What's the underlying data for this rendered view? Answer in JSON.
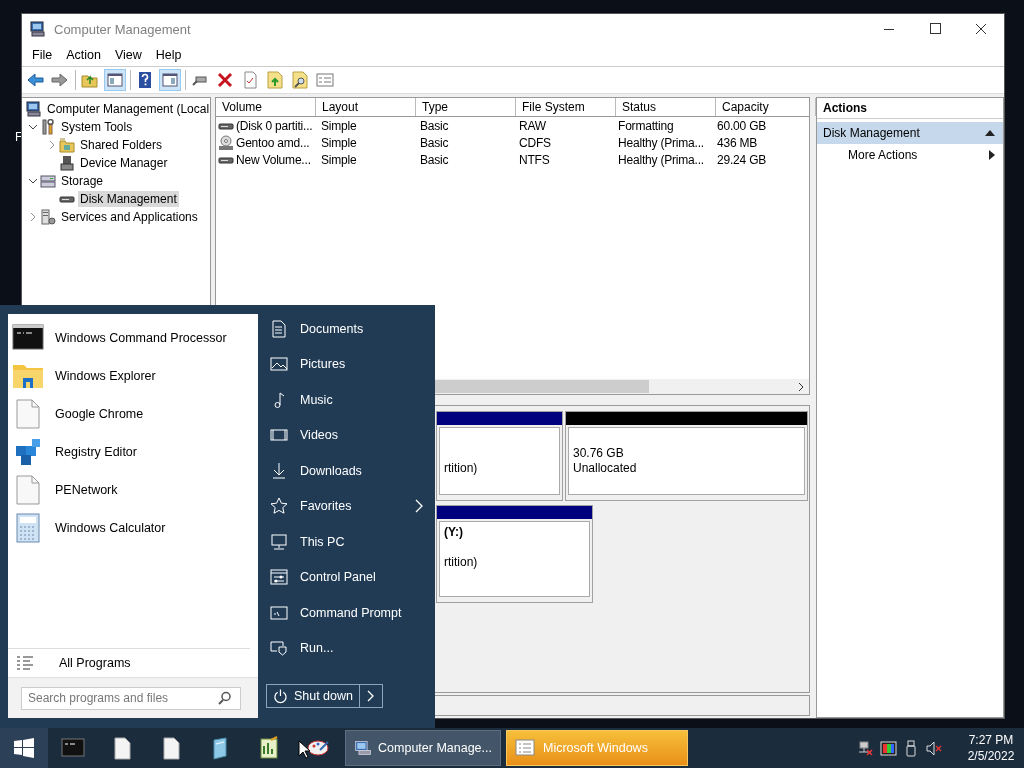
{
  "desktop": {
    "fragment": "F"
  },
  "window": {
    "title": "Computer Management"
  },
  "menu_bar": [
    "File",
    "Action",
    "View",
    "Help"
  ],
  "toolbar": [
    {
      "kind": "back",
      "pressed": false
    },
    {
      "kind": "forward",
      "pressed": false
    },
    {
      "kind": "separator"
    },
    {
      "kind": "up",
      "pressed": false
    },
    {
      "kind": "tree",
      "pressed": true
    },
    {
      "kind": "separator"
    },
    {
      "kind": "help",
      "pressed": false
    },
    {
      "kind": "pane",
      "pressed": true
    },
    {
      "kind": "separator"
    },
    {
      "kind": "connect",
      "pressed": false
    },
    {
      "kind": "delete",
      "pressed": false
    },
    {
      "kind": "properties",
      "pressed": false
    },
    {
      "kind": "export",
      "pressed": false
    },
    {
      "kind": "find",
      "pressed": false
    },
    {
      "kind": "list",
      "pressed": false
    }
  ],
  "tree": [
    {
      "label": "Computer Management (Local",
      "kind": "computer",
      "selected": false,
      "children": [
        {
          "label": "System Tools",
          "kind": "tools",
          "expanded": true,
          "selected": false,
          "children": [
            {
              "label": "Shared Folders",
              "kind": "share",
              "expanded": false,
              "selected": false
            },
            {
              "label": "Device Manager",
              "kind": "device",
              "selected": false
            }
          ]
        },
        {
          "label": "Storage",
          "kind": "storage",
          "expanded": true,
          "selected": false,
          "children": [
            {
              "label": "Disk Management",
              "kind": "disk",
              "selected": true
            }
          ]
        },
        {
          "label": "Services and Applications",
          "kind": "services",
          "expanded": false,
          "selected": false
        }
      ]
    }
  ],
  "table": {
    "columns": [
      "Volume",
      "Layout",
      "Type",
      "File System",
      "Status",
      "Capacity"
    ],
    "rows": [
      {
        "kind": "disk",
        "cells": [
          "(Disk 0 partiti...",
          "Simple",
          "Basic",
          "RAW",
          "Formatting",
          "60.00 GB"
        ]
      },
      {
        "kind": "cd",
        "cells": [
          "Gentoo amd...",
          "Simple",
          "Basic",
          "CDFS",
          "Healthy (Prima...",
          "436 MB"
        ]
      },
      {
        "kind": "disk",
        "cells": [
          "New Volume...",
          "Simple",
          "Basic",
          "NTFS",
          "Healthy (Prima...",
          "29.24 GB"
        ]
      }
    ]
  },
  "disk_map": [
    {
      "partitions": [
        {
          "color": "#00007f",
          "status": "rtition)"
        },
        {
          "color": "#000000",
          "size": "30.76 GB",
          "status": "Unallocated"
        }
      ]
    },
    {
      "partitions": [
        {
          "color": "#00007f",
          "name": "(Y:)",
          "status": "rtition)"
        }
      ]
    }
  ],
  "actions": {
    "title": "Actions",
    "sections": [
      {
        "label": "Disk Management",
        "expanded": true,
        "items": [
          {
            "label": "More Actions",
            "submenu": true
          }
        ]
      }
    ]
  },
  "start_menu": {
    "programs": [
      {
        "label": "Windows Command Processor",
        "kind": "cmd"
      },
      {
        "label": "Windows Explorer",
        "kind": "explorer"
      },
      {
        "label": "Google Chrome",
        "kind": "file"
      },
      {
        "label": "Registry Editor",
        "kind": "registry"
      },
      {
        "label": "PENetwork",
        "kind": "file"
      },
      {
        "label": "Windows Calculator",
        "kind": "calculator"
      }
    ],
    "all_programs": "All Programs",
    "search": {
      "placeholder": "Search programs and files"
    },
    "places": [
      {
        "label": "Documents",
        "kind": "documents",
        "submenu": false
      },
      {
        "label": "Pictures",
        "kind": "pictures",
        "submenu": false
      },
      {
        "label": "Music",
        "kind": "music",
        "submenu": false
      },
      {
        "label": "Videos",
        "kind": "videos",
        "submenu": false
      },
      {
        "label": "Downloads",
        "kind": "downloads",
        "submenu": false
      },
      {
        "label": "Favorites",
        "kind": "star",
        "submenu": true
      },
      {
        "label": "This PC",
        "kind": "pc",
        "submenu": false
      },
      {
        "label": "Control Panel",
        "kind": "control",
        "submenu": false
      },
      {
        "label": "Command Prompt",
        "kind": "prompt",
        "submenu": false
      },
      {
        "label": "Run...",
        "kind": "run",
        "submenu": false
      }
    ],
    "shutdown": "Shut down"
  },
  "taskbar": {
    "pinned": [
      {
        "kind": "cmd"
      },
      {
        "kind": "file"
      },
      {
        "kind": "file"
      },
      {
        "kind": "pen"
      },
      {
        "kind": "notepad"
      },
      {
        "kind": "paint"
      }
    ],
    "tasks": [
      {
        "label": "Computer Manage...",
        "kind": "computer",
        "active": true,
        "flashing": false
      },
      {
        "label": "Microsoft Windows",
        "kind": "list",
        "active": false,
        "flashing": true
      }
    ],
    "tray": [
      {
        "kind": "network"
      },
      {
        "kind": "color"
      },
      {
        "kind": "usb"
      },
      {
        "kind": "mute"
      }
    ],
    "time": "7:27 PM",
    "date": "2/5/2022"
  }
}
